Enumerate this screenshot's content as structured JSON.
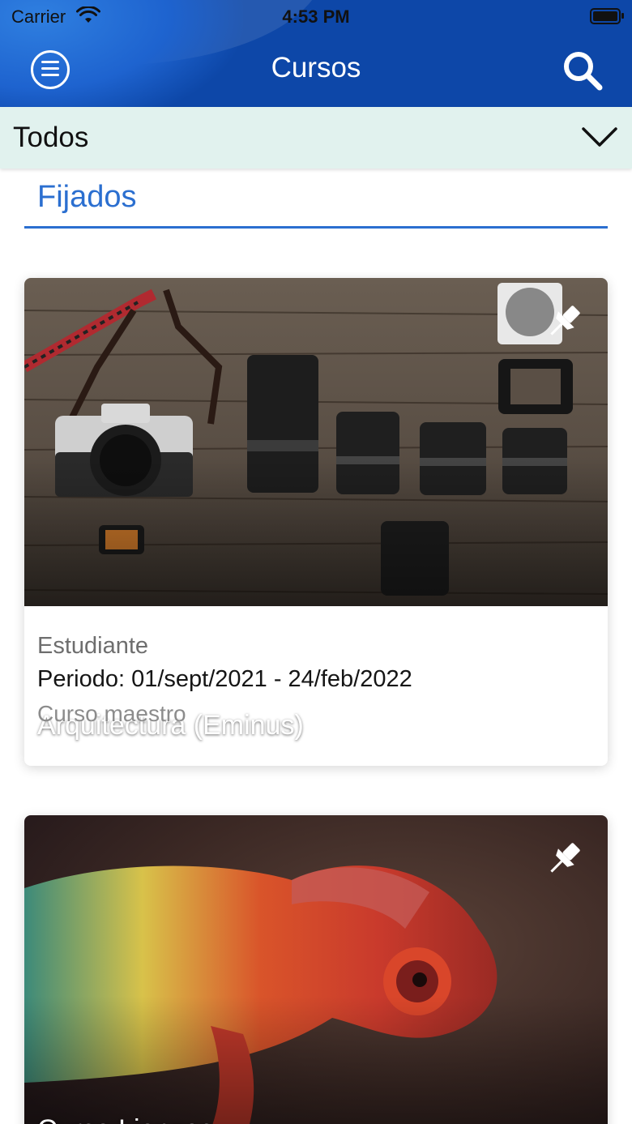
{
  "status_bar": {
    "carrier": "Carrier",
    "time": "4:53 PM"
  },
  "header": {
    "title": "Cursos"
  },
  "filter": {
    "selected": "Todos"
  },
  "section": {
    "title": "Fijados"
  },
  "courses": [
    {
      "title": "Arquitectura (Eminus)",
      "role": "Estudiante",
      "period": "Periodo: 01/sept/2021 - 24/feb/2022",
      "kind": "Curso maestro"
    },
    {
      "title": "Curso Lienzos"
    }
  ],
  "colors": {
    "header_blue": "#0d47a8",
    "accent_blue": "#2b6fd0",
    "filter_bg": "#e1f2ee"
  }
}
